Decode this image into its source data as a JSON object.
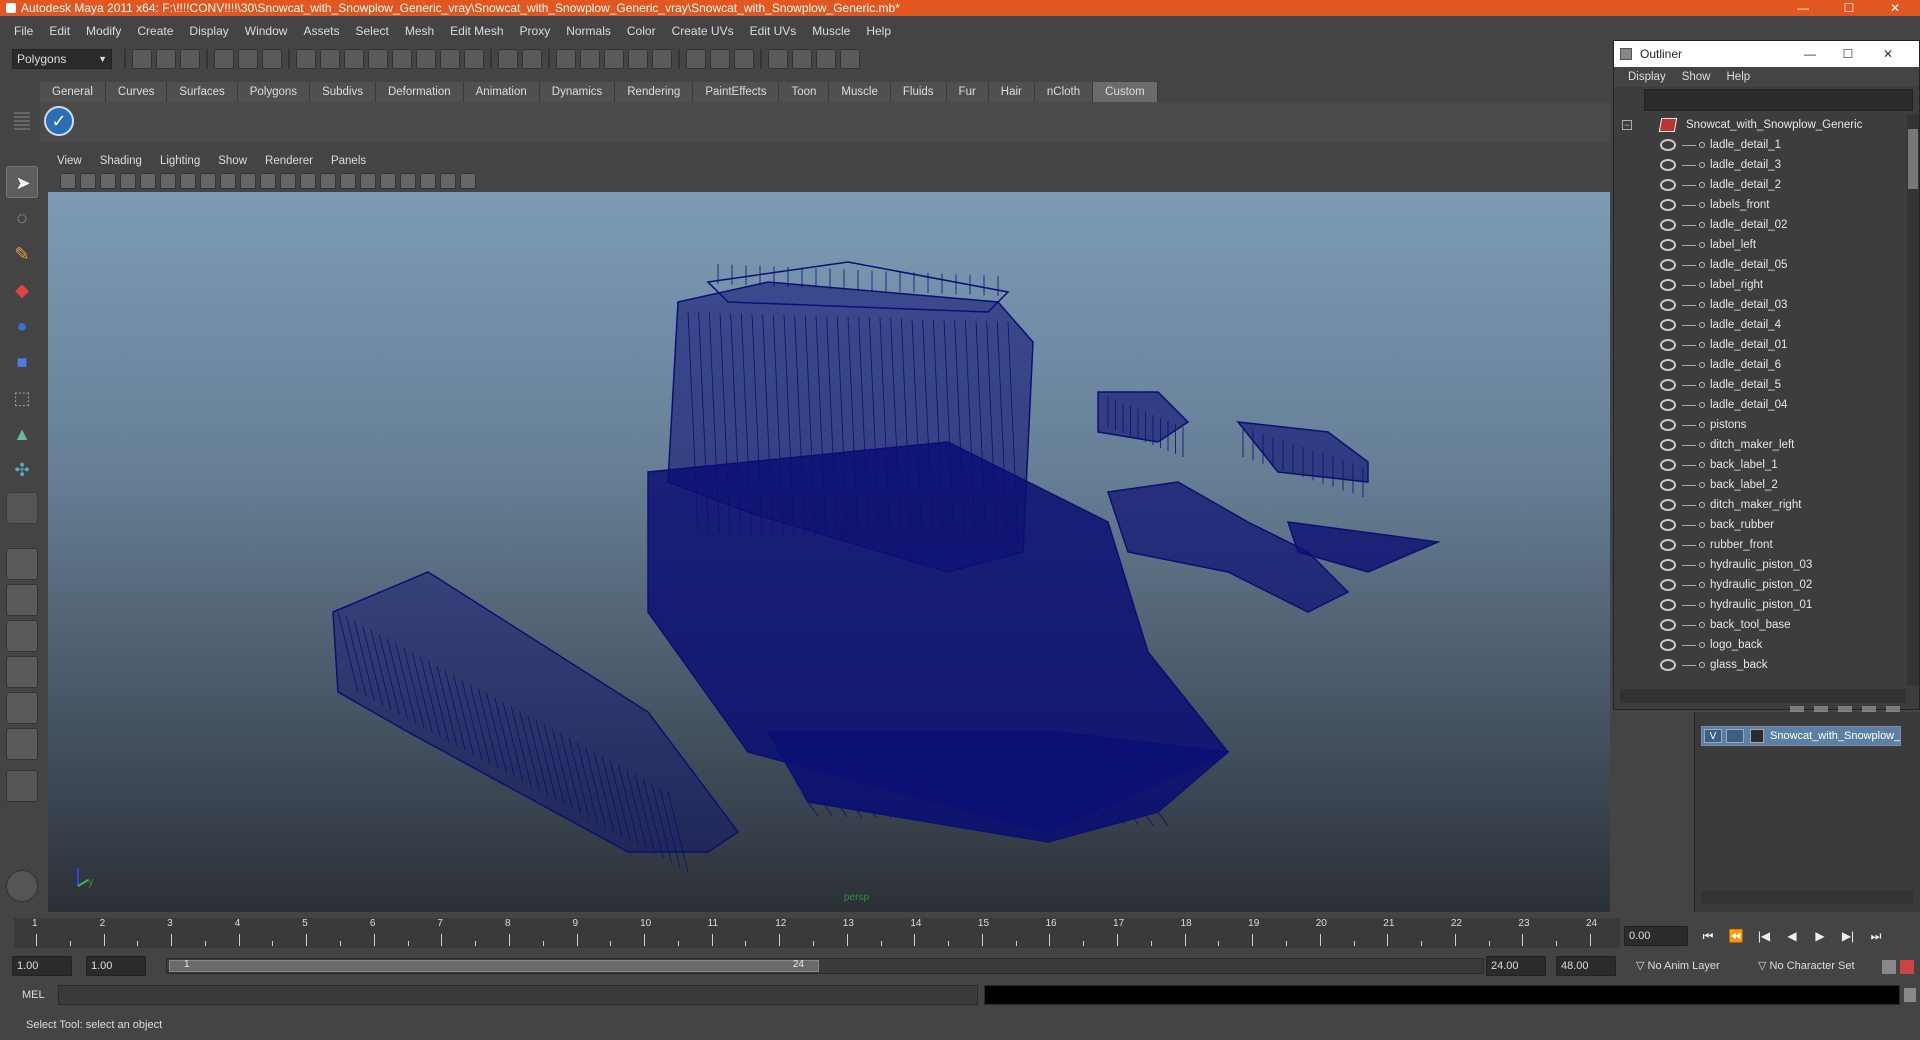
{
  "window": {
    "title": "Autodesk Maya 2011 x64: F:\\!!!!CONV!!!!\\30\\Snowcat_with_Snowplow_Generic_vray\\Snowcat_with_Snowplow_Generic_vray\\Snowcat_with_Snowplow_Generic.mb*",
    "minimize": "—",
    "maximize": "☐",
    "close": "✕"
  },
  "menubar": [
    "File",
    "Edit",
    "Modify",
    "Create",
    "Display",
    "Window",
    "Assets",
    "Select",
    "Mesh",
    "Edit Mesh",
    "Proxy",
    "Normals",
    "Color",
    "Create UVs",
    "Edit UVs",
    "Muscle",
    "Help"
  ],
  "statusline": {
    "mode": "Polygons",
    "mode_arrow": "▼"
  },
  "shelf": {
    "tabs": [
      "General",
      "Curves",
      "Surfaces",
      "Polygons",
      "Subdivs",
      "Deformation",
      "Animation",
      "Dynamics",
      "Rendering",
      "PaintEffects",
      "Toon",
      "Muscle",
      "Fluids",
      "Fur",
      "Hair",
      "nCloth",
      "Custom"
    ],
    "active": "Custom",
    "custom_button_glyph": "✓"
  },
  "toolbox": {
    "tools": [
      {
        "name": "select-tool",
        "glyph": "➤"
      },
      {
        "name": "lasso-tool",
        "glyph": "◌"
      },
      {
        "name": "paint-select-tool",
        "glyph": "✎"
      },
      {
        "name": "move-tool",
        "glyph": "◆"
      },
      {
        "name": "rotate-tool",
        "glyph": "●"
      },
      {
        "name": "scale-tool",
        "glyph": "■"
      },
      {
        "name": "show-manipulator-tool",
        "glyph": "⬚"
      },
      {
        "name": "soft-mod-tool",
        "glyph": "▲"
      },
      {
        "name": "last-used-tool",
        "glyph": "✣"
      }
    ]
  },
  "viewport": {
    "menu": [
      "View",
      "Shading",
      "Lighting",
      "Show",
      "Renderer",
      "Panels"
    ],
    "camera_label": "persp",
    "axis_y": "y",
    "wire_color": "#0b0f73"
  },
  "outliner": {
    "title": "Outliner",
    "menu": [
      "Display",
      "Show",
      "Help"
    ],
    "root": "Snowcat_with_Snowplow_Generic",
    "root_toggle": "−",
    "items": [
      "ladle_detail_1",
      "ladle_detail_3",
      "ladle_detail_2",
      "labels_front",
      "ladle_detail_02",
      "label_left",
      "ladle_detail_05",
      "label_right",
      "ladle_detail_03",
      "ladle_detail_4",
      "ladle_detail_01",
      "ladle_detail_6",
      "ladle_detail_5",
      "ladle_detail_04",
      "pistons",
      "ditch_maker_left",
      "back_label_1",
      "back_label_2",
      "ditch_maker_right",
      "back_rubber",
      "rubber_front",
      "hydraulic_piston_03",
      "hydraulic_piston_02",
      "hydraulic_piston_01",
      "back_tool_base",
      "logo_back",
      "glass_back"
    ]
  },
  "layers": {
    "visible_flag": "V",
    "layer_name": "Snowcat_with_Snowplow_Generic"
  },
  "timeslider": {
    "start": 1,
    "end": 24,
    "current_time": "0.00",
    "playback_buttons": [
      "⏮",
      "⏪",
      "|◀",
      "◀",
      "▶",
      "▶|",
      "⏭"
    ]
  },
  "rangeslider": {
    "start_time": "1.00",
    "playback_start": "1.00",
    "range_start_label": "1",
    "range_end_label": "24",
    "playback_end": "24.00",
    "end_time": "48.00",
    "anim_layer": "No Anim Layer",
    "character_set": "No Character Set"
  },
  "cmdline": {
    "label": "MEL"
  },
  "helpline": {
    "text": "Select Tool: select an object"
  }
}
